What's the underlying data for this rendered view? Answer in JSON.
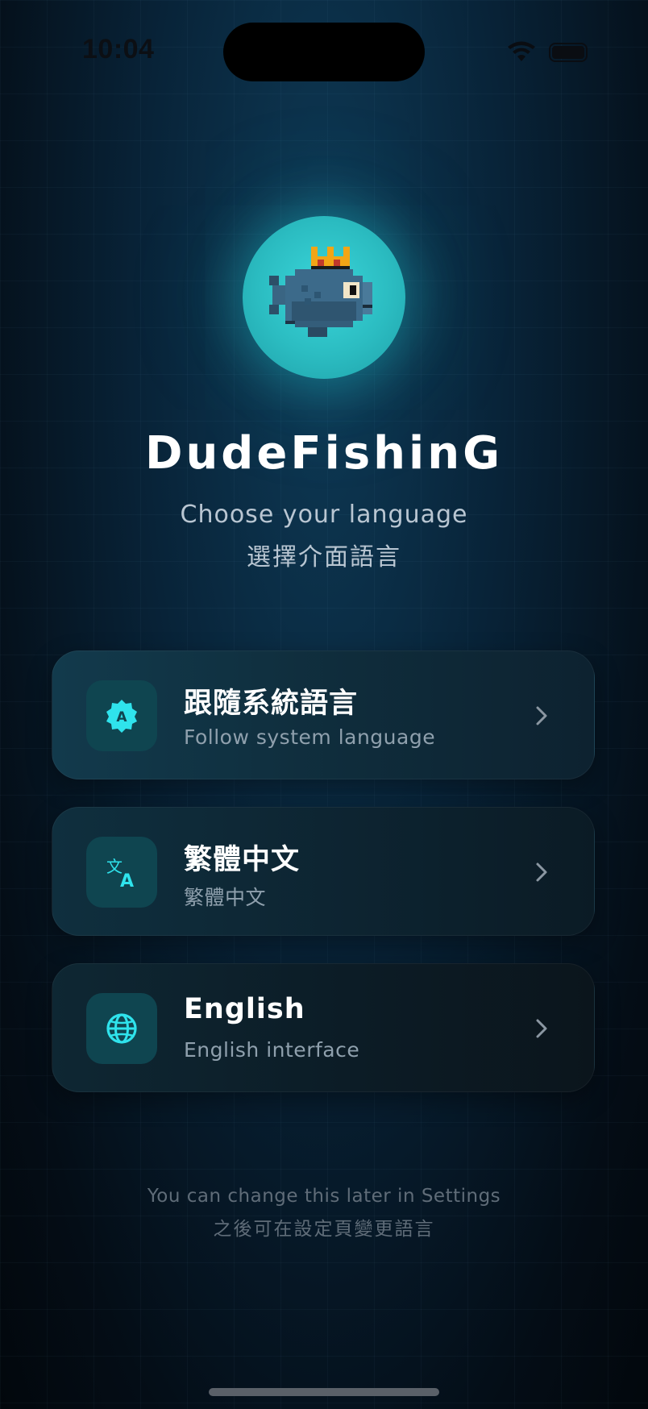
{
  "status_bar": {
    "time": "10:04"
  },
  "app": {
    "name": "DudeFishinG",
    "subtitle_en": "Choose your language",
    "subtitle_zh": "選擇介面語言",
    "accent_color": "#2bbcc1"
  },
  "options": [
    {
      "title": "跟隨系統語言",
      "subtitle": "Follow system language",
      "icon": "auto-language-badge-icon"
    },
    {
      "title": "繁體中文",
      "subtitle": "繁體中文",
      "icon": "translate-icon"
    },
    {
      "title": "English",
      "subtitle": "English interface",
      "icon": "globe-icon"
    }
  ],
  "footer": {
    "note_en": "You can change this later in Settings",
    "note_zh": "之後可在設定頁變更語言"
  }
}
